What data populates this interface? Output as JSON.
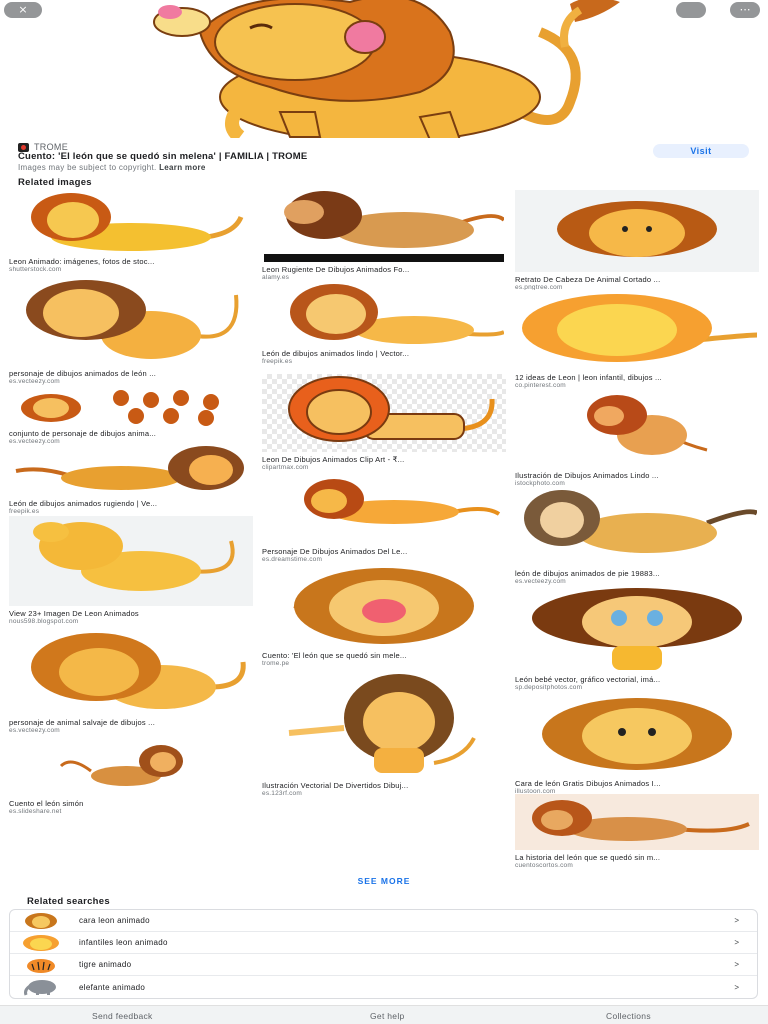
{
  "hero": {
    "close_icon": "×",
    "lens_icon": "lens-icon",
    "more_icon": "⋯"
  },
  "source": {
    "site": "TROME",
    "title": "Cuento: 'El león que se quedó sin melena' | FAMILIA | TROME",
    "copyright": "Images may be subject to copyright.",
    "learn_more": "Learn more",
    "visit": "Visit"
  },
  "related_images": {
    "heading": "Related images",
    "col1": [
      {
        "caption": "Leon Animado: imágenes, fotos de stoc...",
        "domain": "shutterstock.com"
      },
      {
        "caption": "personaje de dibujos animados de león ...",
        "domain": "es.vecteezy.com"
      },
      {
        "caption": "conjunto de personaje de dibujos anima...",
        "domain": "es.vecteezy.com"
      },
      {
        "caption": "León de dibujos animados rugiendo | Ve...",
        "domain": "freepik.es"
      },
      {
        "caption": "View 23+ Imagen De Leon Animados",
        "domain": "nous598.blogspot.com"
      },
      {
        "caption": "personaje de animal salvaje de dibujos ...",
        "domain": "es.vecteezy.com"
      },
      {
        "caption": "Cuento el león simón",
        "domain": "es.slideshare.net"
      }
    ],
    "col2": [
      {
        "caption": "Leon Rugiente De Dibujos Animados Fo...",
        "domain": "alamy.es"
      },
      {
        "caption": "León de dibujos animados lindo | Vector...",
        "domain": "freepik.es"
      },
      {
        "caption": "Leon De Dibujos Animados Clip Art - ₹...",
        "domain": "clipartmax.com"
      },
      {
        "caption": "Personaje De Dibujos Animados Del Le...",
        "domain": "es.dreamstime.com"
      },
      {
        "caption": "Cuento: 'El león que se quedó sin mele...",
        "domain": "trome.pe"
      },
      {
        "caption": "Ilustración Vectorial De Divertidos Dibuj...",
        "domain": "es.123rf.com"
      }
    ],
    "col3": [
      {
        "caption": "Retrato De Cabeza De Animal Cortado ...",
        "domain": "es.pngtree.com"
      },
      {
        "caption": "12 ideas de Leon | leon infantil, dibujos ...",
        "domain": "co.pinterest.com"
      },
      {
        "caption": "Ilustración de Dibujos Animados Lindo ...",
        "domain": "istockphoto.com"
      },
      {
        "caption": "león de dibujos animados de pie 19883...",
        "domain": "es.vecteezy.com"
      },
      {
        "caption": "León bebé vector, gráfico vectorial, imá...",
        "domain": "sp.depositphotos.com"
      },
      {
        "caption": "Cara de león Gratis Dibujos Animados I...",
        "domain": "illustoon.com"
      },
      {
        "caption": "La historia del león que se quedó sin m...",
        "domain": "cuentoscortos.com"
      }
    ],
    "see_more": "SEE MORE"
  },
  "related_searches": {
    "heading": "Related searches",
    "items": [
      {
        "label": "cara leon animado",
        "chevron": ">"
      },
      {
        "label": "infantiles leon animado",
        "chevron": ">"
      },
      {
        "label": "tigre animado",
        "chevron": ">"
      },
      {
        "label": "elefante animado",
        "chevron": ">"
      }
    ]
  },
  "footer": {
    "send_feedback": "Send feedback",
    "get_help": "Get help",
    "collections": "Collections"
  },
  "colors": {
    "accent": "#1a73e8",
    "lion_body": "#f4b63f",
    "lion_mane": "#c8691c"
  }
}
